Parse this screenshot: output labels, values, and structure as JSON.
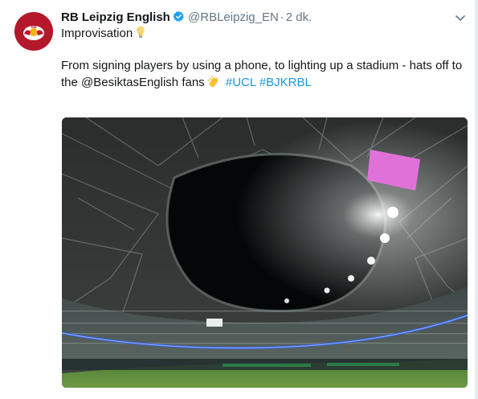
{
  "tweet": {
    "display_name": "RB Leipzig English",
    "handle": "@RBLeipzig_EN",
    "separator": "·",
    "time": "2 dk.",
    "line1": "Improvisation",
    "body_part1": "From signing players by using a phone, to lighting up a stadium - hats off to the",
    "mention": "@BesiktasEnglish",
    "body_part2": "fans",
    "hashtag1": "#UCL",
    "hashtag2": "#BJKRBL"
  },
  "icons": {
    "verified": "verified-badge-icon",
    "caret": "chevron-down-icon",
    "bulb": "light-bulb-emoji",
    "clap": "clapping-hands-emoji"
  },
  "colors": {
    "avatar_bg": "#b4182b",
    "link": "#1b95e0",
    "muted": "#657786",
    "verified": "#1da1f2"
  }
}
